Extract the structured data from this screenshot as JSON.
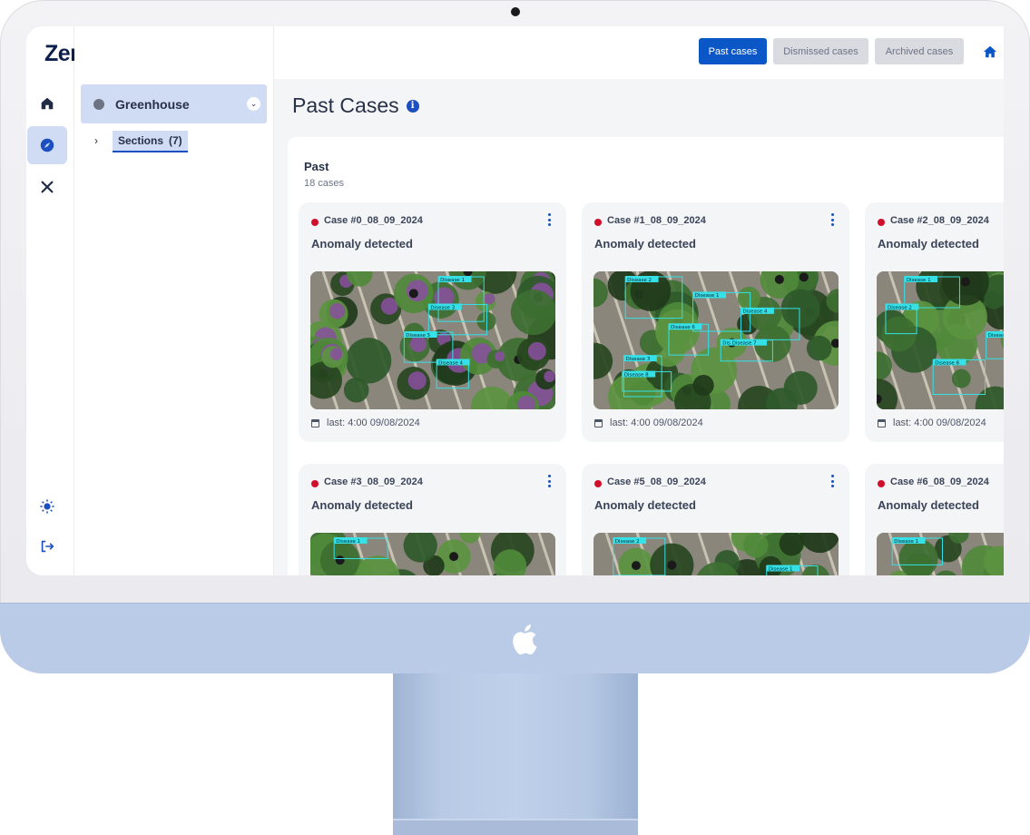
{
  "brand": {
    "name": "Zeraa.ai"
  },
  "rail": {
    "items": [
      {
        "icon": "home-icon"
      },
      {
        "icon": "compass-icon",
        "active": true
      },
      {
        "icon": "tools-icon"
      }
    ],
    "bottom": [
      {
        "icon": "sun-icon"
      },
      {
        "icon": "logout-icon"
      }
    ]
  },
  "tree": {
    "root_label": "Greenhouse",
    "child_label": "Sections",
    "child_count": "(7)"
  },
  "topbar": {
    "past_cases": "Past cases",
    "dismissed_cases": "Dismissed cases",
    "archived_cases": "Archived cases"
  },
  "page": {
    "title": "Past Cases"
  },
  "group": {
    "title": "Past",
    "subtitle": "18 cases"
  },
  "cards": [
    {
      "id": "Case #0_08_09_2024",
      "status": "Anomaly detected",
      "last": "last: 4:00 09/08/2024",
      "labels": [
        "Disease 1",
        "Disease 3",
        "Disease 5",
        "Disease 4"
      ]
    },
    {
      "id": "Case #1_08_09_2024",
      "status": "Anomaly detected",
      "last": "last: 4:00 09/08/2024",
      "labels": [
        "Disease 2",
        "Disease 1",
        "Disease 4",
        "Disease 6",
        "Dis Disease 7",
        "Disease 3",
        "Disease 8"
      ]
    },
    {
      "id": "Case #2_08_09_2024",
      "status": "Anomaly detected",
      "last": "last: 4:00 09/08/2024",
      "labels": [
        "Disease 1",
        "Disease 2",
        "Disease 5",
        "Disease 6"
      ]
    },
    {
      "id": "Case #3_08_09_2024",
      "status": "Anomaly detected",
      "last": "",
      "labels": [
        "Disease 1",
        "Disease 3"
      ]
    },
    {
      "id": "Case #5_08_09_2024",
      "status": "Anomaly detected",
      "last": "",
      "labels": [
        "Disease 2",
        "Disease 1",
        "Dis Disease 7",
        "Disease 8"
      ]
    },
    {
      "id": "Case #6_08_09_2024",
      "status": "Anomaly detected",
      "last": "",
      "labels": [
        "Disease 1",
        "Disease 4"
      ]
    }
  ],
  "colors": {
    "primary": "#0b57c8",
    "status_red": "#d0102a",
    "chin": "#b9cbe6",
    "selection": "#cfdcf4"
  }
}
